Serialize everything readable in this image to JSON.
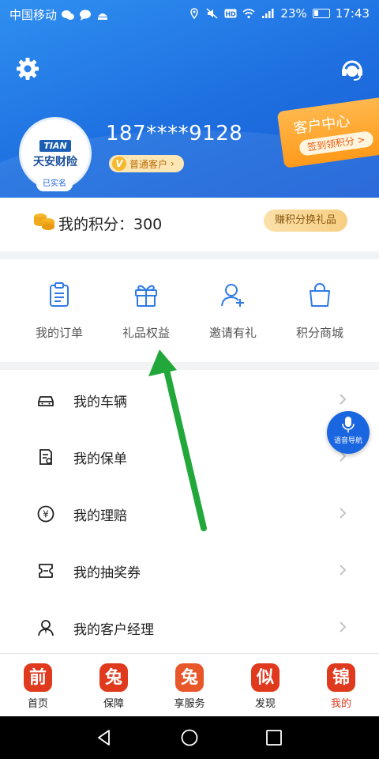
{
  "status_bar": {
    "carrier": "中国移动",
    "network": "4G",
    "battery": "23%",
    "time": "17:43"
  },
  "header": {
    "phone": "187****9128",
    "member_level": "普通客户",
    "avatar_brand_top": "TIAN",
    "avatar_brand": "天安财险",
    "verified": "已实名",
    "customer_center": {
      "title": "客户中心",
      "subtitle": "签到领积分 >"
    }
  },
  "points": {
    "label": "我的积分：300",
    "redeem_button": "赚积分换礼品"
  },
  "quick_actions": [
    {
      "label": "我的订单",
      "icon": "order-icon"
    },
    {
      "label": "礼品权益",
      "icon": "gift-icon"
    },
    {
      "label": "邀请有礼",
      "icon": "invite-icon"
    },
    {
      "label": "积分商城",
      "icon": "shop-bag-icon"
    }
  ],
  "menu": [
    {
      "label": "我的车辆",
      "icon": "car-icon"
    },
    {
      "label": "我的保单",
      "icon": "policy-icon"
    },
    {
      "label": "我的理赔",
      "icon": "claim-icon"
    },
    {
      "label": "我的抽奖券",
      "icon": "ticket-icon"
    },
    {
      "label": "我的客户经理",
      "icon": "manager-icon"
    }
  ],
  "voice_nav": "语音导航",
  "bottom_nav": [
    {
      "label": "首页",
      "glyph": "前",
      "active": false
    },
    {
      "label": "保障",
      "glyph": "兔",
      "active": false
    },
    {
      "label": "享服务",
      "glyph": "兔",
      "active": false
    },
    {
      "label": "发现",
      "glyph": "似",
      "active": false
    },
    {
      "label": "我的",
      "glyph": "锦",
      "active": true
    }
  ],
  "colors": {
    "header_blue": "#1e6fe0",
    "accent_orange": "#ff9a1a",
    "brand_red": "#e03a1e",
    "arrow_green": "#22a83a"
  }
}
